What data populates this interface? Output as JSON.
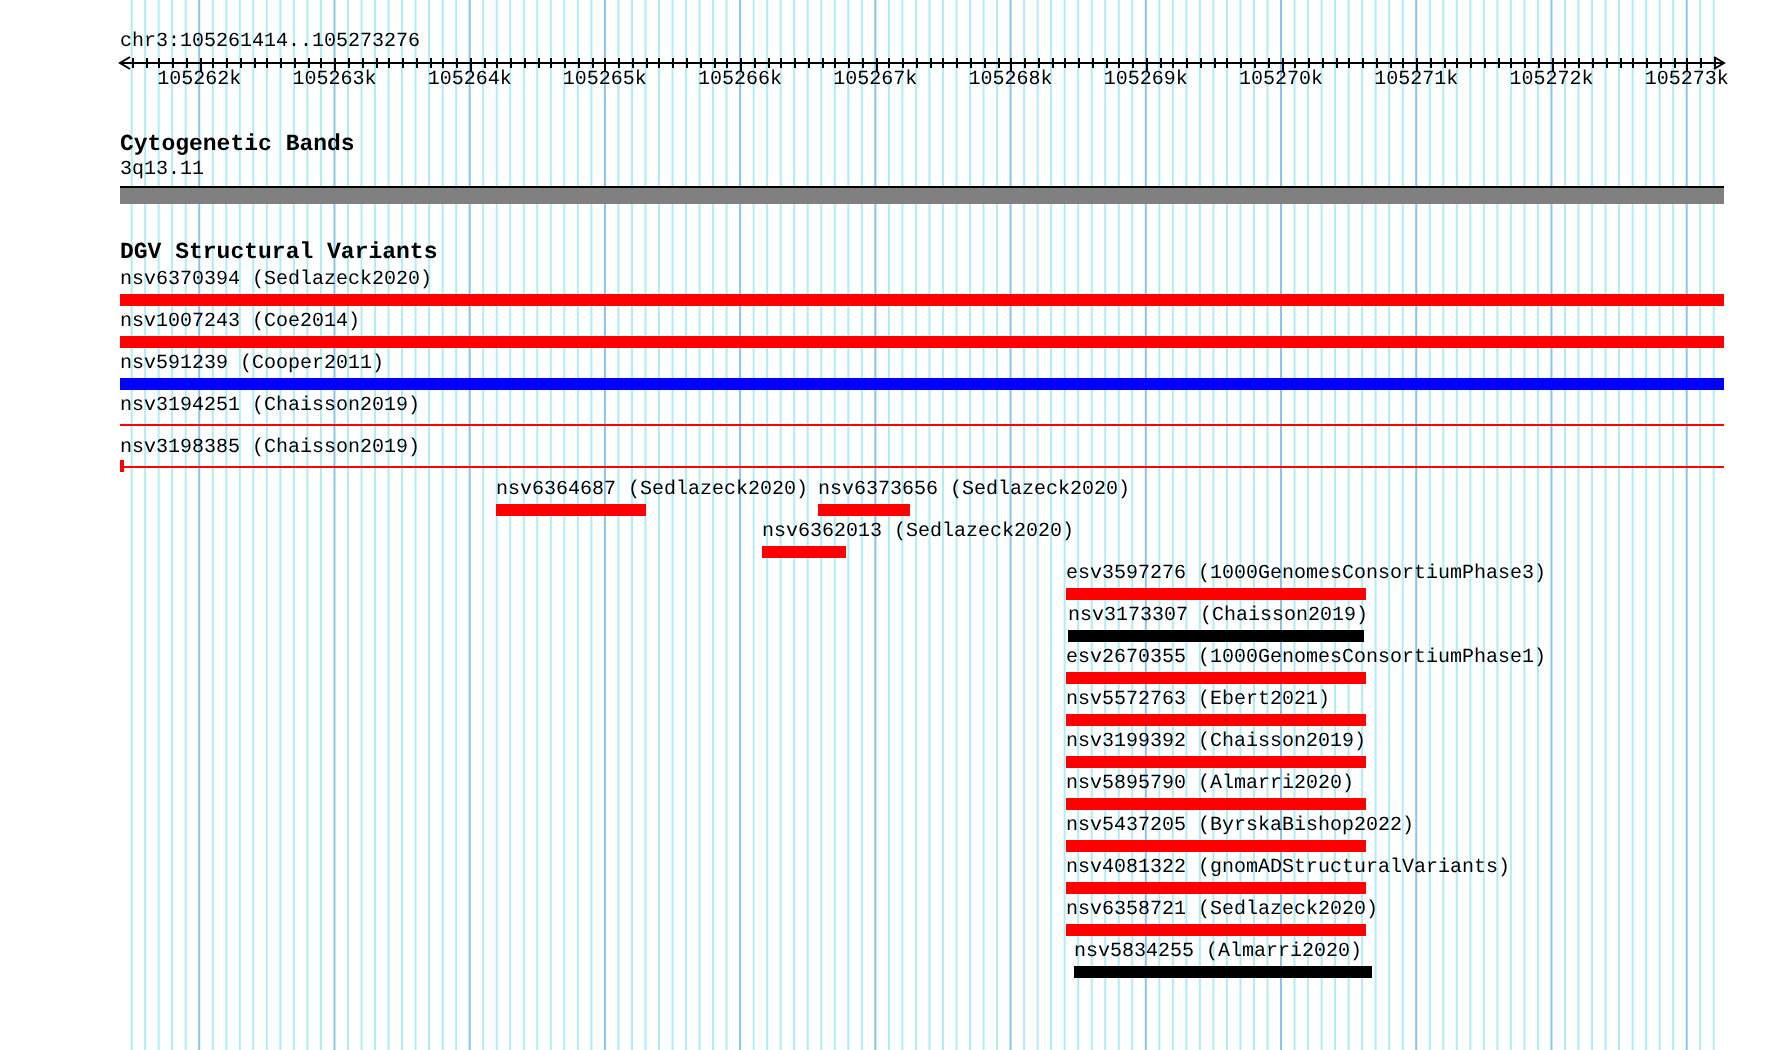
{
  "ruler": {
    "title": "chr3:105261414..105273276",
    "tick_labels": [
      "105262k",
      "105263k",
      "105264k",
      "105265k",
      "105266k",
      "105267k",
      "105268k",
      "105269k",
      "105270k",
      "105271k",
      "105272k",
      "105273k"
    ]
  },
  "cytoband_track": {
    "title": "Cytogenetic Bands",
    "band": {
      "label": "3q13.11",
      "color": "#808080"
    }
  },
  "variants_track": {
    "title": "DGV Structural Variants",
    "features": [
      {
        "label": "nsv6370394 (Sedlazeck2020)",
        "color": "#ff0000",
        "kind": "bar"
      },
      {
        "label": "nsv1007243 (Coe2014)",
        "color": "#ff0000",
        "kind": "bar"
      },
      {
        "label": "nsv591239 (Cooper2011)",
        "color": "#0000ff",
        "kind": "bar"
      },
      {
        "label": "nsv3194251 (Chaisson2019)",
        "color": "#ff0000",
        "kind": "line"
      },
      {
        "label": "nsv3198385 (Chaisson2019)",
        "color": "#ff0000",
        "kind": "capped"
      },
      {
        "label": "nsv6364687 (Sedlazeck2020)",
        "color": "#ff0000",
        "kind": "bar"
      },
      {
        "label": "nsv6373656 (Sedlazeck2020)",
        "color": "#ff0000",
        "kind": "bar"
      },
      {
        "label": "nsv6362013 (Sedlazeck2020)",
        "color": "#ff0000",
        "kind": "bar"
      },
      {
        "label": "esv3597276 (1000GenomesConsortiumPhase3)",
        "color": "#ff0000",
        "kind": "bar"
      },
      {
        "label": "nsv3173307 (Chaisson2019)",
        "color": "#000000",
        "kind": "bar"
      },
      {
        "label": "esv2670355 (1000GenomesConsortiumPhase1)",
        "color": "#ff0000",
        "kind": "bar"
      },
      {
        "label": "nsv5572763 (Ebert2021)",
        "color": "#ff0000",
        "kind": "bar"
      },
      {
        "label": "nsv3199392 (Chaisson2019)",
        "color": "#ff0000",
        "kind": "bar"
      },
      {
        "label": "nsv5895790 (Almarri2020)",
        "color": "#ff0000",
        "kind": "bar"
      },
      {
        "label": "nsv5437205 (ByrskaBishop2022)",
        "color": "#ff0000",
        "kind": "bar"
      },
      {
        "label": "nsv4081322 (gnomADStructuralVariants)",
        "color": "#ff0000",
        "kind": "bar"
      },
      {
        "label": "nsv6358721 (Sedlazeck2020)",
        "color": "#ff0000",
        "kind": "bar"
      },
      {
        "label": "nsv5834255 (Almarri2020)",
        "color": "#000000",
        "kind": "bar"
      }
    ]
  }
}
